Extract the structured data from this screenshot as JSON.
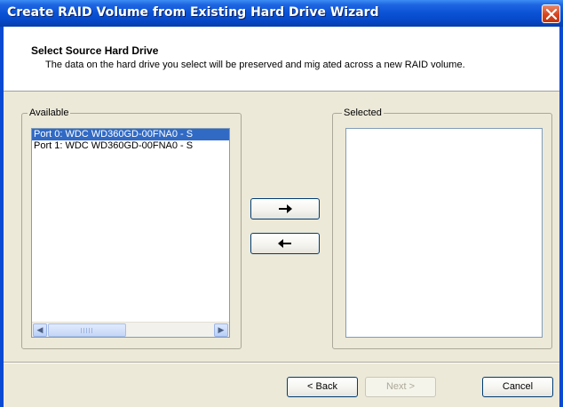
{
  "window": {
    "title": "Create RAID Volume from Existing Hard Drive Wizard"
  },
  "header": {
    "title": "Select Source Hard Drive",
    "description": "The data on the hard drive you select will be preserved and mig ated across a new RAID volume."
  },
  "available": {
    "label": "Available",
    "items": [
      {
        "label": "Port 0: WDC WD360GD-00FNA0 - S",
        "selected": true
      },
      {
        "label": "Port 1: WDC WD360GD-00FNA0 - S",
        "selected": false
      }
    ]
  },
  "selected": {
    "label": "Selected",
    "items": []
  },
  "transfer": {
    "add_icon": "arrow-right-icon",
    "remove_icon": "arrow-left-icon"
  },
  "scrollbar": {
    "left_icon": "scroll-left-icon",
    "right_icon": "scroll-right-icon"
  },
  "footer": {
    "back_label": "< Back",
    "next_label": "Next >",
    "cancel_label": "Cancel"
  },
  "colors": {
    "title_bar": "#0a52d6",
    "selection": "#316ac5",
    "dialog_bg": "#ece9d8"
  }
}
